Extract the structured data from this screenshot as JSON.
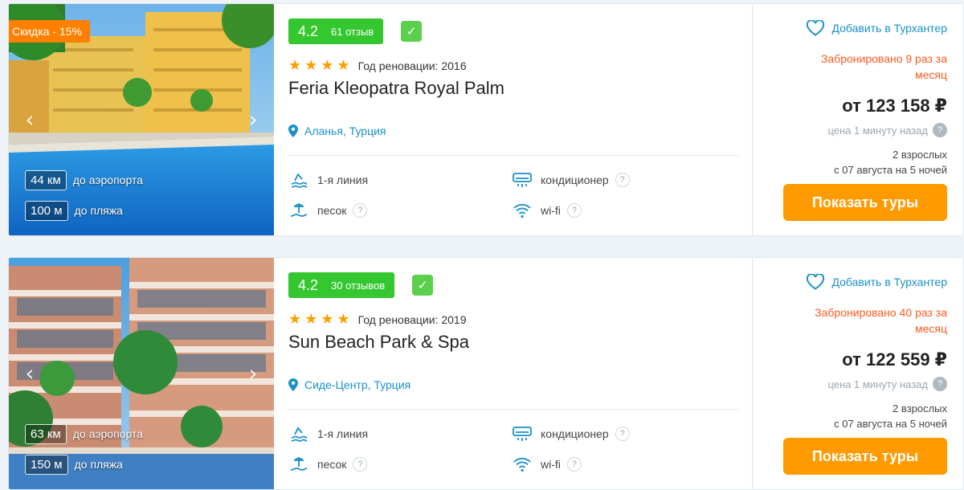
{
  "hotels": [
    {
      "discount": "Скидка - 15%",
      "photo_prev": "‹",
      "photo_next": "›",
      "airport_km": "44 км",
      "airport_label": "до аэропорта",
      "beach_m": "100 м",
      "beach_label": "до пляжа",
      "score": "4.2",
      "reviews": "61 отзыв",
      "verified_icon": "check-icon",
      "stars": 4,
      "renovation": "Год реновации: 2016",
      "name": "Feria Kleopatra Royal Palm",
      "location": "Аланья, Турция",
      "features": {
        "line": "1-я линия",
        "beach_type": "песок",
        "ac": "кондиционер",
        "wifi": "wi-fi",
        "help": "?"
      },
      "favorite_label": "Добавить в Турхантер",
      "booked_text": "Забронировано 9 раз за месяц",
      "price": "от 123 158 ₽",
      "price_note": "цена 1 минуту назад",
      "price_help": "?",
      "pax": "2 взрослых",
      "dates": "с 07 августа на 5 ночей",
      "cta": "Показать туры"
    },
    {
      "discount": "",
      "photo_prev": "‹",
      "photo_next": "›",
      "airport_km": "63 км",
      "airport_label": "до аэропорта",
      "beach_m": "150 м",
      "beach_label": "до пляжа",
      "score": "4.2",
      "reviews": "30 отзывов",
      "verified_icon": "check-icon",
      "stars": 4,
      "renovation": "Год реновации: 2019",
      "name": "Sun Beach Park & Spa",
      "location": "Сиде-Центр, Турция",
      "features": {
        "line": "1-я линия",
        "beach_type": "песок",
        "ac": "кондиционер",
        "wifi": "wi-fi",
        "help": "?"
      },
      "favorite_label": "Добавить в Турхантер",
      "booked_text": "Забронировано 40 раз за месяц",
      "price": "от 122 559 ₽",
      "price_note": "цена 1 минуту назад",
      "price_help": "?",
      "pax": "2 взрослых",
      "dates": "с 07 августа на 5 ночей",
      "cta": "Показать туры"
    }
  ],
  "colors": {
    "accent": "#ff9a00",
    "rating_green": "#34c72f",
    "link_blue": "#1a90c9",
    "booked_red": "#ff5a1f",
    "discount_orange": "#ff7f00"
  }
}
